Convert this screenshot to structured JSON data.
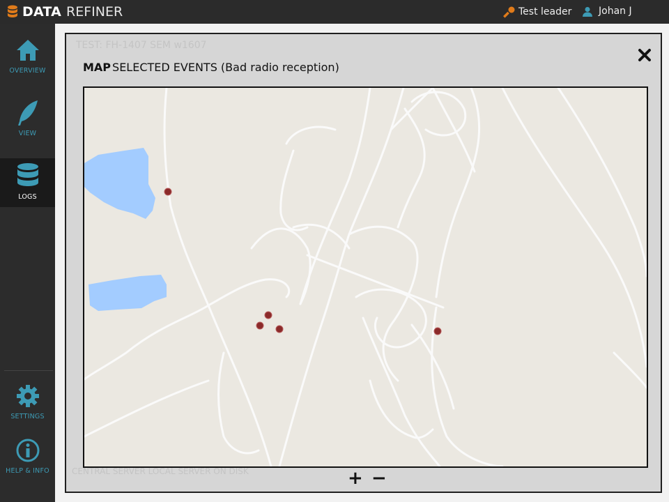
{
  "app": {
    "brand_bold": "DATA",
    "brand_light": "REFINER",
    "role": "Test leader",
    "user": "Johan J"
  },
  "sidebar": {
    "items": [
      {
        "label": "OVERVIEW",
        "icon": "home-icon"
      },
      {
        "label": "VIEW",
        "icon": "feather-icon"
      },
      {
        "label": "LOGS",
        "icon": "database-icon",
        "active": true
      },
      {
        "label": "SETTINGS",
        "icon": "gear-icon"
      },
      {
        "label": "HELP & INFO",
        "icon": "info-icon"
      }
    ]
  },
  "modal": {
    "title_bold": "MAP",
    "title_rest": "SELECTED EVENTS (Bad radio reception)",
    "close_label": "✖",
    "zoom_in_label": "+",
    "zoom_out_label": "−"
  },
  "map": {
    "event_markers": 5,
    "colors": {
      "land": "#ebe8e1",
      "water": "#a3ccff",
      "road": "#ffffff",
      "marker": "#8b2a2a"
    }
  },
  "background_page": {
    "test_header": "TEST: FH-1407 SEM w1607",
    "footer": "CENTRAL SERVER   LOCAL SERVER   ON DISK"
  }
}
